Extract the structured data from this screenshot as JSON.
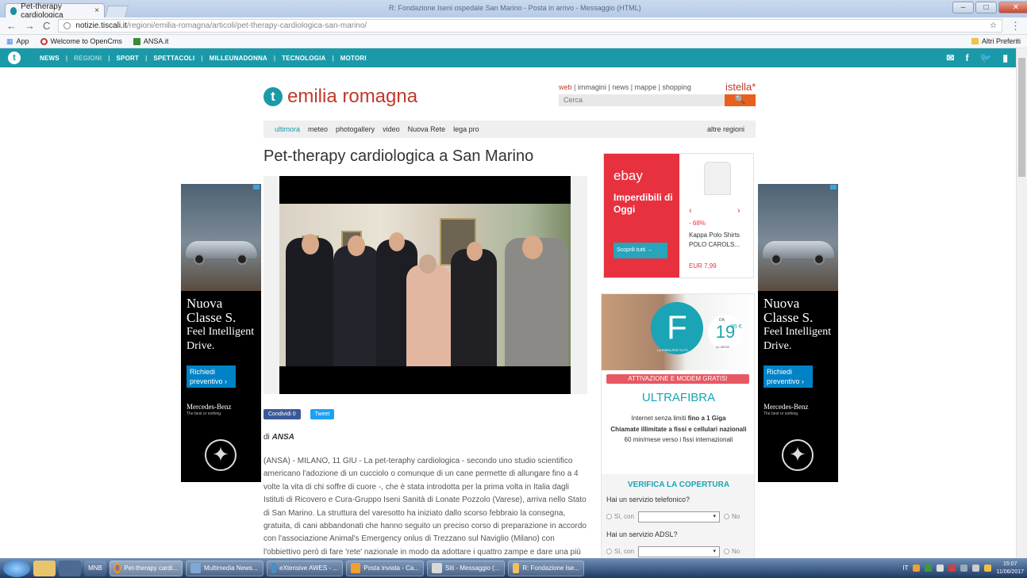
{
  "browser": {
    "tab_title": "Pet-therapy cardiologica",
    "tab_close": "×",
    "window_title": "R: Fondazione Iseni ospedale San Marino - Posta in arrivo - Messaggio (HTML)",
    "window_controls": [
      "–",
      "□",
      "✕"
    ],
    "nav_back": "←",
    "nav_forward": "→",
    "nav_reload": "C",
    "url_host": "notizie.tiscali.it",
    "url_path": "/regioni/emilia-romagna/articoli/pet-therapy-cardiologica-san-marino/",
    "star": "☆",
    "menu": "⋮",
    "bookmarks": [
      "App",
      "Welcome to OpenCms",
      "ANSA.it"
    ],
    "bookmarks_right": "Altri Preferiti"
  },
  "sitenav": {
    "logo": "t",
    "items": [
      "NEWS",
      "REGIONI",
      "SPORT",
      "SPETTACOLI",
      "MILLEUNADONNA",
      "TECNOLOGIA",
      "MOTORI"
    ],
    "separator": "|",
    "icons": [
      "✉",
      "f",
      "🐦",
      "▮"
    ]
  },
  "header": {
    "brand_logo": "t",
    "brand_name": "emilia romagna",
    "search_links_first": "web",
    "search_links_rest": " | immagini | news | mappe | shopping",
    "istella": "istella*",
    "search_placeholder": "Cerca",
    "search_button": "🔍"
  },
  "subnav": {
    "items": [
      "ultimora",
      "meteo",
      "photogallery",
      "video",
      "Nuova Rete",
      "lega pro"
    ],
    "right": "altre regioni"
  },
  "article": {
    "headline": "Pet-therapy cardiologica a San Marino",
    "share_facebook": "Condividi 0",
    "share_twitter": "Tweet",
    "byline_prefix": "di ",
    "byline_source": "ANSA",
    "body": "(ANSA) - MILANO, 11 GIU - La pet-teraphy cardiologica - secondo uno studio scientifico americano l'adozione di un cucciolo o comunque di un cane permette di allungare fino a 4 volte la vita di chi soffre di cuore -, che è stata introdotta per la prima volta in Italia dagli Istituti di Ricovero e Cura-Gruppo Iseni Sanità di Lonate Pozzolo (Varese), arriva nello Stato di San Marino. La struttura del varesotto ha iniziato dallo scorso febbraio la consegna, gratuita, di cani abbandonati che hanno seguito un preciso corso di preparazione in accordo con l'associazione Animal's Emergency onlus di Trezzano sul Naviglio (Milano) con l'obbiettivo però di fare 'rete' nazionale in modo da adottare i quattro zampe e dare una più lunga e"
  },
  "ad_mercedes": {
    "headline_line1": "Nuova",
    "headline_line2": "Classe S.",
    "headline_line3": "Feel Intelligent",
    "headline_line4": "Drive.",
    "cta": "Richiedi preventivo ›",
    "brand": "Mercedes-Benz",
    "tagline": "The best or nothing.",
    "emblem": "✦"
  },
  "ad_ebay": {
    "logo": "ebay",
    "title": "Imperdibili di Oggi",
    "button": "Scoprili tutti →",
    "arrow_left": "‹",
    "arrow_right": "›",
    "discount": "- 68%",
    "product": "Kappa Polo Shirts POLO CAROLS...",
    "price": "EUR 7,99"
  },
  "ad_fiber": {
    "letter": "F",
    "tiny_label": "LA FIBRA PER TUTTI",
    "da": "DA",
    "price": "19",
    "cents": "95 €",
    "per_month": "AL MESE",
    "promo": "ATTIVAZIONE E MODEM GRATIS!",
    "title": "ULTRAFIBRA",
    "line1_prefix": "Internet senza limiti ",
    "line1_bold": "fino a 1 Giga",
    "line2_bold": "Chiamate illimitate a fissi e cellulari nazionali",
    "line3": "60 min/mese verso i fissi internazionali",
    "verifica": "VERIFICA LA COPERTURA",
    "q1": "Hai un servizio telefonico?",
    "q2": "Hai un servizio ADSL?",
    "si_con": "Sì, con",
    "no": "No",
    "select_arrow": "▾"
  },
  "taskbar": {
    "pinned_mnb": "MNB",
    "tasks": [
      "Pet-therapy cardi...",
      "Multimedia News...",
      "eXtensive AWES - ...",
      "Posta inviata - Ca...",
      "Siti - Messaggio (...",
      "R: Fondazione Ise..."
    ],
    "lang": "IT",
    "time": "15:07",
    "date": "11/06/2017"
  },
  "colors": {
    "teal": "#1a9aa8",
    "red": "#c0392b",
    "ebay_red": "#e7313f",
    "fiber_teal": "#1aa4b5"
  }
}
